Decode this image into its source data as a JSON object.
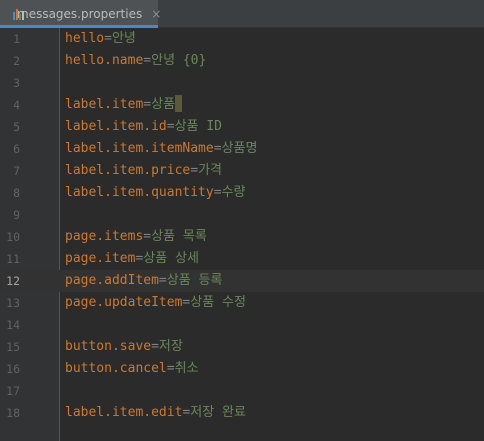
{
  "tab": {
    "icon": "properties-file-icon",
    "filename": "messages.properties",
    "close_glyph": "×"
  },
  "colors": {
    "key": "#cc7832",
    "separator": "#808080",
    "value": "#6a8759",
    "line_number": "#606366",
    "background": "#2b2b2b",
    "gutter": "#313335",
    "current_line": "#323232",
    "tab_accent": "#4a88c7"
  },
  "editor": {
    "current_line": 12,
    "lines": [
      {
        "num": "1",
        "key": "hello",
        "sep": "=",
        "value": "안녕"
      },
      {
        "num": "2",
        "key": "hello.name",
        "sep": "=",
        "value": "안녕 {0}"
      },
      {
        "num": "3",
        "key": "",
        "sep": "",
        "value": ""
      },
      {
        "num": "4",
        "key": "label.item",
        "sep": "=",
        "value": "상품"
      },
      {
        "num": "5",
        "key": "label.item.id",
        "sep": "=",
        "value": "상품 ID"
      },
      {
        "num": "6",
        "key": "label.item.itemName",
        "sep": "=",
        "value": "상품명"
      },
      {
        "num": "7",
        "key": "label.item.price",
        "sep": "=",
        "value": "가격"
      },
      {
        "num": "8",
        "key": "label.item.quantity",
        "sep": "=",
        "value": "수량"
      },
      {
        "num": "9",
        "key": "",
        "sep": "",
        "value": ""
      },
      {
        "num": "10",
        "key": "page.items",
        "sep": "=",
        "value": "상품 목록"
      },
      {
        "num": "11",
        "key": "page.item",
        "sep": "=",
        "value": "상품 상세"
      },
      {
        "num": "12",
        "key": "page.addItem",
        "sep": "=",
        "value": "상품 등록"
      },
      {
        "num": "13",
        "key": "page.updateItem",
        "sep": "=",
        "value": "상품 수정"
      },
      {
        "num": "14",
        "key": "",
        "sep": "",
        "value": ""
      },
      {
        "num": "15",
        "key": "button.save",
        "sep": "=",
        "value": "저장"
      },
      {
        "num": "16",
        "key": "button.cancel",
        "sep": "=",
        "value": "취소"
      },
      {
        "num": "17",
        "key": "",
        "sep": "",
        "value": ""
      },
      {
        "num": "18",
        "key": "label.item.edit",
        "sep": "=",
        "value": "저장 완료"
      }
    ]
  }
}
